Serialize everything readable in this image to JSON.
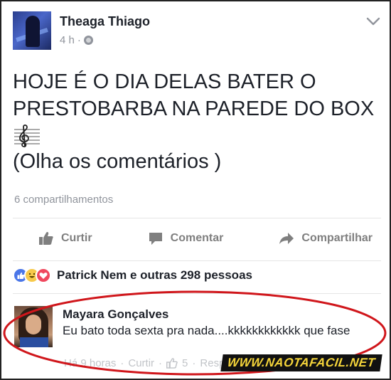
{
  "post": {
    "author": "Theaga Thiago",
    "time": "4 h",
    "separator": "·",
    "text_lines": [
      "HOJE É O DIA DELAS BATER O",
      "PRESTOBARBA NA PAREDE DO BOX"
    ],
    "music_icon": "treble-clef-icon",
    "text_line3": "(Olha os comentários )",
    "shares": "6 compartilhamentos"
  },
  "actions": {
    "like_label": "Curtir",
    "comment_label": "Comentar",
    "share_label": "Compartilhar"
  },
  "reactions": {
    "text": "Patrick Nem e outras 298 pessoas",
    "icons": [
      "like-reaction-icon",
      "haha-reaction-icon",
      "love-reaction-icon"
    ]
  },
  "comment": {
    "author": "Mayara Gonçalves",
    "text": "Eu bato toda sexta pra nada....kkkkkkkkkkkk que fase",
    "time": "Há 9 horas",
    "like_label": "Curtir",
    "like_count": "5",
    "reply_label": "Respo"
  },
  "watermark": "WWW.NAOTAFACIL.NET",
  "colors": {
    "muted": "#90949c",
    "highlight": "#d0161b",
    "watermark_text": "#f5d53a"
  }
}
